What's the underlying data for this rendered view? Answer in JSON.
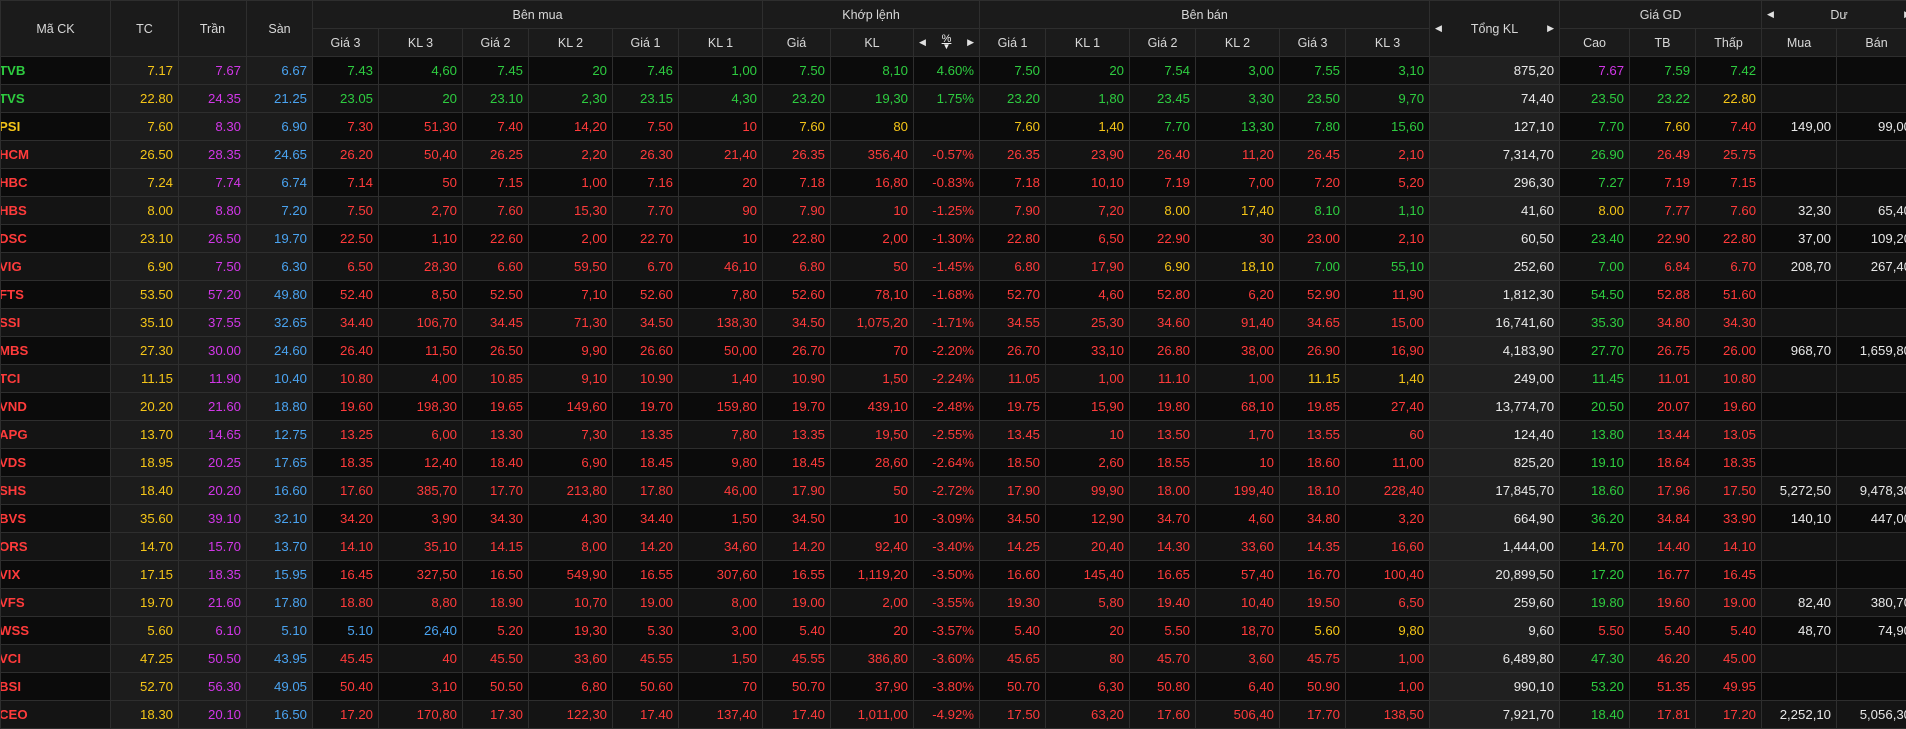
{
  "colors": {
    "up": "#2ecc40",
    "down": "#ff3b3b",
    "ref": "#f5c518",
    "ceil": "#d237e8",
    "floor": "#4aa3f0",
    "neutral": "#e8e8e8"
  },
  "headers": {
    "code": "Mã CK",
    "tc": "TC",
    "tran": "Trần",
    "san": "Sàn",
    "ben_mua": "Bên mua",
    "khop_lenh": "Khớp lệnh",
    "ben_ban": "Bên bán",
    "tong_kl": "Tổng KL",
    "gia_gd": "Giá GD",
    "du": "Dư",
    "buy_sub": [
      "Giá 3",
      "KL 3",
      "Giá 2",
      "KL 2",
      "Giá 1",
      "KL 1"
    ],
    "match_gia": "Giá",
    "match_kl": "KL",
    "match_pct": "%",
    "sell_sub": [
      "Giá 1",
      "KL 1",
      "Giá 2",
      "KL 2",
      "Giá 3",
      "KL 3"
    ],
    "gd_sub": [
      "Cao",
      "TB",
      "Thấp"
    ],
    "du_sub": [
      "Mua",
      "Bán"
    ]
  },
  "rows": [
    {
      "code": "TVB",
      "tc": "7.17",
      "tran": "7.67",
      "san": "6.67",
      "b3": "7.43",
      "bk3": "4,60",
      "b2": "7.45",
      "bk2": "20",
      "b1": "7.46",
      "bk1": "1,00",
      "m": "7.50",
      "mk": "8,10",
      "pct": "4.60%",
      "s1": "7.50",
      "sk1": "20",
      "s2": "7.54",
      "sk2": "3,00",
      "s3": "7.55",
      "sk3": "3,10",
      "tkl": "875,20",
      "cao": "7.67",
      "tb": "7.59",
      "thap": "7.42",
      "dmua": "",
      "dban": ""
    },
    {
      "code": "TVS",
      "tc": "22.80",
      "tran": "24.35",
      "san": "21.25",
      "b3": "23.05",
      "bk3": "20",
      "b2": "23.10",
      "bk2": "2,30",
      "b1": "23.15",
      "bk1": "4,30",
      "m": "23.20",
      "mk": "19,30",
      "pct": "1.75%",
      "s1": "23.20",
      "sk1": "1,80",
      "s2": "23.45",
      "sk2": "3,30",
      "s3": "23.50",
      "sk3": "9,70",
      "tkl": "74,40",
      "cao": "23.50",
      "tb": "23.22",
      "thap": "22.80",
      "dmua": "",
      "dban": ""
    },
    {
      "code": "PSI",
      "tc": "7.60",
      "tran": "8.30",
      "san": "6.90",
      "b3": "7.30",
      "bk3": "51,30",
      "b2": "7.40",
      "bk2": "14,20",
      "b1": "7.50",
      "bk1": "10",
      "m": "7.60",
      "mk": "80",
      "pct": "",
      "s1": "7.60",
      "sk1": "1,40",
      "s2": "7.70",
      "sk2": "13,30",
      "s3": "7.80",
      "sk3": "15,60",
      "tkl": "127,10",
      "cao": "7.70",
      "tb": "7.60",
      "thap": "7.40",
      "dmua": "149,00",
      "dban": "99,00"
    },
    {
      "code": "HCM",
      "tc": "26.50",
      "tran": "28.35",
      "san": "24.65",
      "b3": "26.20",
      "bk3": "50,40",
      "b2": "26.25",
      "bk2": "2,20",
      "b1": "26.30",
      "bk1": "21,40",
      "m": "26.35",
      "mk": "356,40",
      "pct": "-0.57%",
      "s1": "26.35",
      "sk1": "23,90",
      "s2": "26.40",
      "sk2": "11,20",
      "s3": "26.45",
      "sk3": "2,10",
      "tkl": "7,314,70",
      "cao": "26.90",
      "tb": "26.49",
      "thap": "25.75",
      "dmua": "",
      "dban": ""
    },
    {
      "code": "HBC",
      "tc": "7.24",
      "tran": "7.74",
      "san": "6.74",
      "b3": "7.14",
      "bk3": "50",
      "b2": "7.15",
      "bk2": "1,00",
      "b1": "7.16",
      "bk1": "20",
      "m": "7.18",
      "mk": "16,80",
      "pct": "-0.83%",
      "s1": "7.18",
      "sk1": "10,10",
      "s2": "7.19",
      "sk2": "7,00",
      "s3": "7.20",
      "sk3": "5,20",
      "tkl": "296,30",
      "cao": "7.27",
      "tb": "7.19",
      "thap": "7.15",
      "dmua": "",
      "dban": ""
    },
    {
      "code": "HBS",
      "tc": "8.00",
      "tran": "8.80",
      "san": "7.20",
      "b3": "7.50",
      "bk3": "2,70",
      "b2": "7.60",
      "bk2": "15,30",
      "b1": "7.70",
      "bk1": "90",
      "m": "7.90",
      "mk": "10",
      "pct": "-1.25%",
      "s1": "7.90",
      "sk1": "7,20",
      "s2": "8.00",
      "sk2": "17,40",
      "s3": "8.10",
      "sk3": "1,10",
      "tkl": "41,60",
      "cao": "8.00",
      "tb": "7.77",
      "thap": "7.60",
      "dmua": "32,30",
      "dban": "65,40"
    },
    {
      "code": "DSC",
      "tc": "23.10",
      "tran": "26.50",
      "san": "19.70",
      "b3": "22.50",
      "bk3": "1,10",
      "b2": "22.60",
      "bk2": "2,00",
      "b1": "22.70",
      "bk1": "10",
      "m": "22.80",
      "mk": "2,00",
      "pct": "-1.30%",
      "s1": "22.80",
      "sk1": "6,50",
      "s2": "22.90",
      "sk2": "30",
      "s3": "23.00",
      "sk3": "2,10",
      "tkl": "60,50",
      "cao": "23.40",
      "tb": "22.90",
      "thap": "22.80",
      "dmua": "37,00",
      "dban": "109,20"
    },
    {
      "code": "VIG",
      "tc": "6.90",
      "tran": "7.50",
      "san": "6.30",
      "b3": "6.50",
      "bk3": "28,30",
      "b2": "6.60",
      "bk2": "59,50",
      "b1": "6.70",
      "bk1": "46,10",
      "m": "6.80",
      "mk": "50",
      "pct": "-1.45%",
      "s1": "6.80",
      "sk1": "17,90",
      "s2": "6.90",
      "sk2": "18,10",
      "s3": "7.00",
      "sk3": "55,10",
      "tkl": "252,60",
      "cao": "7.00",
      "tb": "6.84",
      "thap": "6.70",
      "dmua": "208,70",
      "dban": "267,40"
    },
    {
      "code": "FTS",
      "tc": "53.50",
      "tran": "57.20",
      "san": "49.80",
      "b3": "52.40",
      "bk3": "8,50",
      "b2": "52.50",
      "bk2": "7,10",
      "b1": "52.60",
      "bk1": "7,80",
      "m": "52.60",
      "mk": "78,10",
      "pct": "-1.68%",
      "s1": "52.70",
      "sk1": "4,60",
      "s2": "52.80",
      "sk2": "6,20",
      "s3": "52.90",
      "sk3": "11,90",
      "tkl": "1,812,30",
      "cao": "54.50",
      "tb": "52.88",
      "thap": "51.60",
      "dmua": "",
      "dban": ""
    },
    {
      "code": "SSI",
      "tc": "35.10",
      "tran": "37.55",
      "san": "32.65",
      "b3": "34.40",
      "bk3": "106,70",
      "b2": "34.45",
      "bk2": "71,30",
      "b1": "34.50",
      "bk1": "138,30",
      "m": "34.50",
      "mk": "1,075,20",
      "pct": "-1.71%",
      "s1": "34.55",
      "sk1": "25,30",
      "s2": "34.60",
      "sk2": "91,40",
      "s3": "34.65",
      "sk3": "15,00",
      "tkl": "16,741,60",
      "cao": "35.30",
      "tb": "34.80",
      "thap": "34.30",
      "dmua": "",
      "dban": ""
    },
    {
      "code": "MBS",
      "tc": "27.30",
      "tran": "30.00",
      "san": "24.60",
      "b3": "26.40",
      "bk3": "11,50",
      "b2": "26.50",
      "bk2": "9,90",
      "b1": "26.60",
      "bk1": "50,00",
      "m": "26.70",
      "mk": "70",
      "pct": "-2.20%",
      "s1": "26.70",
      "sk1": "33,10",
      "s2": "26.80",
      "sk2": "38,00",
      "s3": "26.90",
      "sk3": "16,90",
      "tkl": "4,183,90",
      "cao": "27.70",
      "tb": "26.75",
      "thap": "26.00",
      "dmua": "968,70",
      "dban": "1,659,80"
    },
    {
      "code": "TCI",
      "tc": "11.15",
      "tran": "11.90",
      "san": "10.40",
      "b3": "10.80",
      "bk3": "4,00",
      "b2": "10.85",
      "bk2": "9,10",
      "b1": "10.90",
      "bk1": "1,40",
      "m": "10.90",
      "mk": "1,50",
      "pct": "-2.24%",
      "s1": "11.05",
      "sk1": "1,00",
      "s2": "11.10",
      "sk2": "1,00",
      "s3": "11.15",
      "sk3": "1,40",
      "tkl": "249,00",
      "cao": "11.45",
      "tb": "11.01",
      "thap": "10.80",
      "dmua": "",
      "dban": ""
    },
    {
      "code": "VND",
      "tc": "20.20",
      "tran": "21.60",
      "san": "18.80",
      "b3": "19.60",
      "bk3": "198,30",
      "b2": "19.65",
      "bk2": "149,60",
      "b1": "19.70",
      "bk1": "159,80",
      "m": "19.70",
      "mk": "439,10",
      "pct": "-2.48%",
      "s1": "19.75",
      "sk1": "15,90",
      "s2": "19.80",
      "sk2": "68,10",
      "s3": "19.85",
      "sk3": "27,40",
      "tkl": "13,774,70",
      "cao": "20.50",
      "tb": "20.07",
      "thap": "19.60",
      "dmua": "",
      "dban": ""
    },
    {
      "code": "APG",
      "tc": "13.70",
      "tran": "14.65",
      "san": "12.75",
      "b3": "13.25",
      "bk3": "6,00",
      "b2": "13.30",
      "bk2": "7,30",
      "b1": "13.35",
      "bk1": "7,80",
      "m": "13.35",
      "mk": "19,50",
      "pct": "-2.55%",
      "s1": "13.45",
      "sk1": "10",
      "s2": "13.50",
      "sk2": "1,70",
      "s3": "13.55",
      "sk3": "60",
      "tkl": "124,40",
      "cao": "13.80",
      "tb": "13.44",
      "thap": "13.05",
      "dmua": "",
      "dban": ""
    },
    {
      "code": "VDS",
      "tc": "18.95",
      "tran": "20.25",
      "san": "17.65",
      "b3": "18.35",
      "bk3": "12,40",
      "b2": "18.40",
      "bk2": "6,90",
      "b1": "18.45",
      "bk1": "9,80",
      "m": "18.45",
      "mk": "28,60",
      "pct": "-2.64%",
      "s1": "18.50",
      "sk1": "2,60",
      "s2": "18.55",
      "sk2": "10",
      "s3": "18.60",
      "sk3": "11,00",
      "tkl": "825,20",
      "cao": "19.10",
      "tb": "18.64",
      "thap": "18.35",
      "dmua": "",
      "dban": ""
    },
    {
      "code": "SHS",
      "tc": "18.40",
      "tran": "20.20",
      "san": "16.60",
      "b3": "17.60",
      "bk3": "385,70",
      "b2": "17.70",
      "bk2": "213,80",
      "b1": "17.80",
      "bk1": "46,00",
      "m": "17.90",
      "mk": "50",
      "pct": "-2.72%",
      "s1": "17.90",
      "sk1": "99,90",
      "s2": "18.00",
      "sk2": "199,40",
      "s3": "18.10",
      "sk3": "228,40",
      "tkl": "17,845,70",
      "cao": "18.60",
      "tb": "17.96",
      "thap": "17.50",
      "dmua": "5,272,50",
      "dban": "9,478,30"
    },
    {
      "code": "BVS",
      "tc": "35.60",
      "tran": "39.10",
      "san": "32.10",
      "b3": "34.20",
      "bk3": "3,90",
      "b2": "34.30",
      "bk2": "4,30",
      "b1": "34.40",
      "bk1": "1,50",
      "m": "34.50",
      "mk": "10",
      "pct": "-3.09%",
      "s1": "34.50",
      "sk1": "12,90",
      "s2": "34.70",
      "sk2": "4,60",
      "s3": "34.80",
      "sk3": "3,20",
      "tkl": "664,90",
      "cao": "36.20",
      "tb": "34.84",
      "thap": "33.90",
      "dmua": "140,10",
      "dban": "447,00"
    },
    {
      "code": "ORS",
      "tc": "14.70",
      "tran": "15.70",
      "san": "13.70",
      "b3": "14.10",
      "bk3": "35,10",
      "b2": "14.15",
      "bk2": "8,00",
      "b1": "14.20",
      "bk1": "34,60",
      "m": "14.20",
      "mk": "92,40",
      "pct": "-3.40%",
      "s1": "14.25",
      "sk1": "20,40",
      "s2": "14.30",
      "sk2": "33,60",
      "s3": "14.35",
      "sk3": "16,60",
      "tkl": "1,444,00",
      "cao": "14.70",
      "tb": "14.40",
      "thap": "14.10",
      "dmua": "",
      "dban": ""
    },
    {
      "code": "VIX",
      "tc": "17.15",
      "tran": "18.35",
      "san": "15.95",
      "b3": "16.45",
      "bk3": "327,50",
      "b2": "16.50",
      "bk2": "549,90",
      "b1": "16.55",
      "bk1": "307,60",
      "m": "16.55",
      "mk": "1,119,20",
      "pct": "-3.50%",
      "s1": "16.60",
      "sk1": "145,40",
      "s2": "16.65",
      "sk2": "57,40",
      "s3": "16.70",
      "sk3": "100,40",
      "tkl": "20,899,50",
      "cao": "17.20",
      "tb": "16.77",
      "thap": "16.45",
      "dmua": "",
      "dban": ""
    },
    {
      "code": "VFS",
      "tc": "19.70",
      "tran": "21.60",
      "san": "17.80",
      "b3": "18.80",
      "bk3": "8,80",
      "b2": "18.90",
      "bk2": "10,70",
      "b1": "19.00",
      "bk1": "8,00",
      "m": "19.00",
      "mk": "2,00",
      "pct": "-3.55%",
      "s1": "19.30",
      "sk1": "5,80",
      "s2": "19.40",
      "sk2": "10,40",
      "s3": "19.50",
      "sk3": "6,50",
      "tkl": "259,60",
      "cao": "19.80",
      "tb": "19.60",
      "thap": "19.00",
      "dmua": "82,40",
      "dban": "380,70"
    },
    {
      "code": "WSS",
      "tc": "5.60",
      "tran": "6.10",
      "san": "5.10",
      "b3": "5.10",
      "bk3": "26,40",
      "b2": "5.20",
      "bk2": "19,30",
      "b1": "5.30",
      "bk1": "3,00",
      "m": "5.40",
      "mk": "20",
      "pct": "-3.57%",
      "s1": "5.40",
      "sk1": "20",
      "s2": "5.50",
      "sk2": "18,70",
      "s3": "5.60",
      "sk3": "9,80",
      "tkl": "9,60",
      "cao": "5.50",
      "tb": "5.40",
      "thap": "5.40",
      "dmua": "48,70",
      "dban": "74,90"
    },
    {
      "code": "VCI",
      "tc": "47.25",
      "tran": "50.50",
      "san": "43.95",
      "b3": "45.45",
      "bk3": "40",
      "b2": "45.50",
      "bk2": "33,60",
      "b1": "45.55",
      "bk1": "1,50",
      "m": "45.55",
      "mk": "386,80",
      "pct": "-3.60%",
      "s1": "45.65",
      "sk1": "80",
      "s2": "45.70",
      "sk2": "3,60",
      "s3": "45.75",
      "sk3": "1,00",
      "tkl": "6,489,80",
      "cao": "47.30",
      "tb": "46.20",
      "thap": "45.00",
      "dmua": "",
      "dban": ""
    },
    {
      "code": "BSI",
      "tc": "52.70",
      "tran": "56.30",
      "san": "49.05",
      "b3": "50.40",
      "bk3": "3,10",
      "b2": "50.50",
      "bk2": "6,80",
      "b1": "50.60",
      "bk1": "70",
      "m": "50.70",
      "mk": "37,90",
      "pct": "-3.80%",
      "s1": "50.70",
      "sk1": "6,30",
      "s2": "50.80",
      "sk2": "6,40",
      "s3": "50.90",
      "sk3": "1,00",
      "tkl": "990,10",
      "cao": "53.20",
      "tb": "51.35",
      "thap": "49.95",
      "dmua": "",
      "dban": ""
    },
    {
      "code": "CEO",
      "tc": "18.30",
      "tran": "20.10",
      "san": "16.50",
      "b3": "17.20",
      "bk3": "170,80",
      "b2": "17.30",
      "bk2": "122,30",
      "b1": "17.40",
      "bk1": "137,40",
      "m": "17.40",
      "mk": "1,011,00",
      "pct": "-4.92%",
      "s1": "17.50",
      "sk1": "63,20",
      "s2": "17.60",
      "sk2": "506,40",
      "s3": "17.70",
      "sk3": "138,50",
      "tkl": "7,921,70",
      "cao": "18.40",
      "tb": "17.81",
      "thap": "17.20",
      "dmua": "2,252,10",
      "dban": "5,056,30"
    }
  ]
}
